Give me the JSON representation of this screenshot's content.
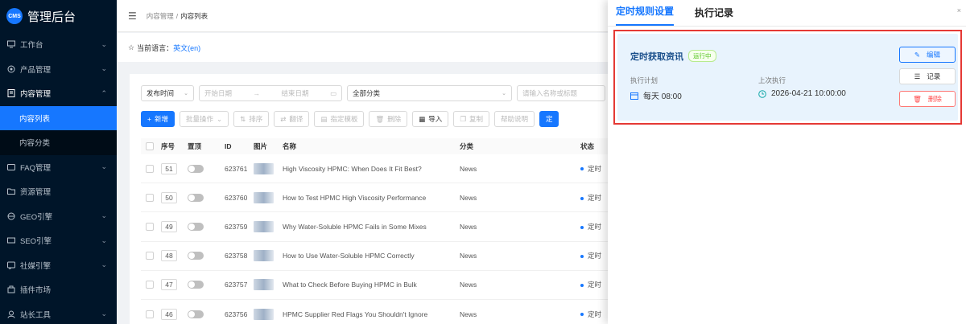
{
  "sidebar": {
    "logo_text": "CMS",
    "title": "管理后台",
    "items": [
      {
        "label": "工作台",
        "icon": "dashboard-icon"
      },
      {
        "label": "产品管理",
        "icon": "product-icon"
      },
      {
        "label": "内容管理",
        "icon": "document-icon"
      },
      {
        "label": "内容列表",
        "icon": ""
      },
      {
        "label": "内容分类",
        "icon": ""
      },
      {
        "label": "FAQ管理",
        "icon": "faq-icon"
      },
      {
        "label": "资源管理",
        "icon": "folder-icon"
      },
      {
        "label": "GEO引擎",
        "icon": "geo-icon"
      },
      {
        "label": "SEO引擎",
        "icon": "seo-icon"
      },
      {
        "label": "社媒引擎",
        "icon": "social-icon"
      },
      {
        "label": "插件市场",
        "icon": "plugin-icon"
      },
      {
        "label": "站长工具",
        "icon": "tools-icon"
      }
    ]
  },
  "breadcrumb": {
    "parent": "内容管理",
    "separator": "/",
    "current": "内容列表"
  },
  "language": {
    "label": "当前语言：",
    "value": "英文(en)"
  },
  "filters": {
    "time_select": "发布时间",
    "start_date": "开始日期",
    "end_date": "结束日期",
    "category_select": "全部分类",
    "search_placeholder": "请输入名称或标题"
  },
  "toolbar": {
    "add": "新增",
    "batch": "批量操作",
    "sort": "排序",
    "translate": "翻译",
    "specify_template": "指定模板",
    "delete": "删除",
    "import": "导入",
    "copy": "复制",
    "help": "帮助说明",
    "scheduled": "定"
  },
  "table": {
    "headers": [
      "序号",
      "置顶",
      "ID",
      "图片",
      "名称",
      "分类",
      "状态"
    ],
    "rows": [
      {
        "sort": "51",
        "id": "623761",
        "name": "High Viscosity HPMC: When Does It Fit Best?",
        "category": "News",
        "status": "定时"
      },
      {
        "sort": "50",
        "id": "623760",
        "name": "How to Test HPMC High Viscosity Performance",
        "category": "News",
        "status": "定时"
      },
      {
        "sort": "49",
        "id": "623759",
        "name": "Why Water-Soluble HPMC Fails in Some Mixes",
        "category": "News",
        "status": "定时"
      },
      {
        "sort": "48",
        "id": "623758",
        "name": "How to Use Water-Soluble HPMC Correctly",
        "category": "News",
        "status": "定时"
      },
      {
        "sort": "47",
        "id": "623757",
        "name": "What to Check Before Buying HPMC in Bulk",
        "category": "News",
        "status": "定时"
      },
      {
        "sort": "46",
        "id": "623756",
        "name": "HPMC Supplier Red Flags You Shouldn't Ignore",
        "category": "News",
        "status": "定时"
      }
    ]
  },
  "drawer": {
    "tabs": [
      "定时规则设置",
      "执行记录"
    ],
    "close": "×",
    "rule": {
      "name": "定时获取资讯",
      "status": "运行中",
      "plan_label": "执行计划",
      "plan_value": "每天 08:00",
      "last_label": "上次执行",
      "last_value": "2026-04-21 10:00:00",
      "edit": "编辑",
      "log": "记录",
      "delete": "删除"
    }
  },
  "colors": {
    "accent": "#1677ff",
    "sidebar_bg": "#001529",
    "danger": "#ff4d4f",
    "success": "#52c41a",
    "highlight_border": "#e53935"
  }
}
